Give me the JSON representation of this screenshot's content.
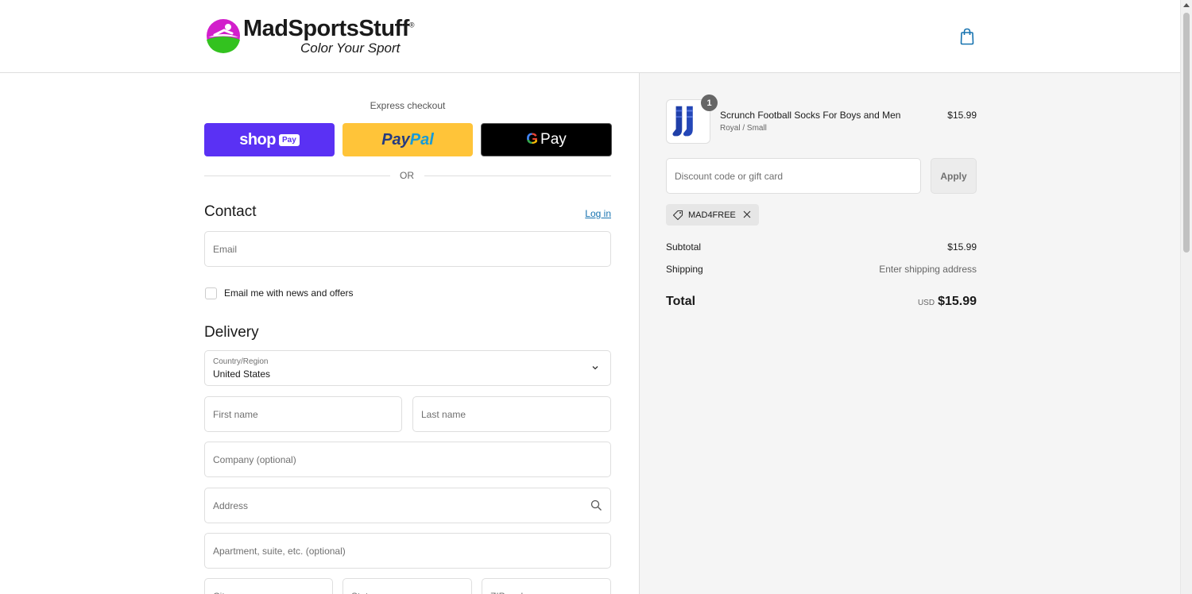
{
  "header": {
    "brand_name": "MadSportsStuff",
    "brand_trademark": "®",
    "brand_tagline": "Color Your Sport",
    "cart_icon": "shopping-bag-icon"
  },
  "express": {
    "label": "Express checkout",
    "shop_pay": {
      "word": "shop",
      "badge": "Pay"
    },
    "paypal": {
      "part1": "Pay",
      "part2": "Pal"
    },
    "gpay": {
      "g": "G",
      "word": "Pay"
    },
    "or_label": "OR"
  },
  "contact": {
    "title": "Contact",
    "login_link": "Log in",
    "email_placeholder": "Email",
    "newsletter_label": "Email me with news and offers"
  },
  "delivery": {
    "title": "Delivery",
    "country_label": "Country/Region",
    "country_value": "United States",
    "first_name_placeholder": "First name",
    "last_name_placeholder": "Last name",
    "company_placeholder": "Company (optional)",
    "address_placeholder": "Address",
    "apartment_placeholder": "Apartment, suite, etc. (optional)",
    "city_placeholder": "City",
    "state_placeholder": "State",
    "zip_placeholder": "ZIP code"
  },
  "summary": {
    "item": {
      "name": "Scrunch Football Socks For Boys and Men",
      "variant": "Royal / Small",
      "price": "$15.99",
      "quantity": "1"
    },
    "discount_placeholder": "Discount code or gift card",
    "apply_label": "Apply",
    "applied_code": "MAD4FREE",
    "subtotal_label": "Subtotal",
    "subtotal_value": "$15.99",
    "shipping_label": "Shipping",
    "shipping_value": "Enter shipping address",
    "total_label": "Total",
    "total_currency": "USD",
    "total_value": "$15.99"
  },
  "colors": {
    "shop_pay": "#5a31f4",
    "paypal": "#ffc439",
    "gpay": "#000000",
    "link": "#1773b0",
    "summary_bg": "#f5f5f5"
  }
}
